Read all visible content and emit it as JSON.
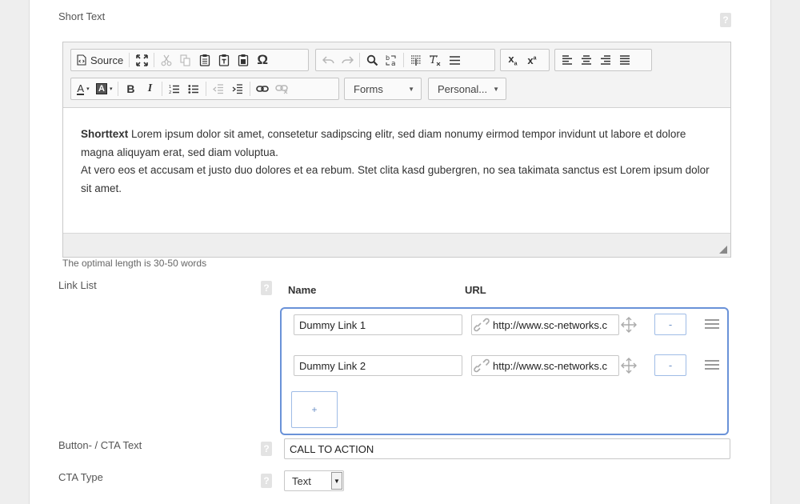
{
  "short_text": {
    "label": "Short Text",
    "help": "?",
    "hint": "The optimal length is 30-50 words"
  },
  "toolbar": {
    "source_label": "Source",
    "forms_label": "Forms",
    "personal_label": "Personal..."
  },
  "editor_content": {
    "bold_word": "Shorttext",
    "para1_rest": " Lorem ipsum dolor sit amet, consetetur sadipscing elitr, sed diam nonumy eirmod tempor invidunt ut labore et dolore magna aliquyam erat, sed diam voluptua.",
    "para2": "At vero eos et accusam et justo duo dolores et ea rebum. Stet clita kasd gubergren, no sea takimata sanctus est Lorem ipsum dolor sit amet."
  },
  "link_list": {
    "label": "Link List",
    "help": "?",
    "col_name": "Name",
    "col_url": "URL",
    "rows": [
      {
        "name": "Dummy Link 1",
        "url": "http://www.sc-networks.c",
        "remove": "-"
      },
      {
        "name": "Dummy Link 2",
        "url": "http://www.sc-networks.c",
        "remove": "-"
      }
    ],
    "add": "+"
  },
  "cta_text": {
    "label": "Button- / CTA Text",
    "help": "?",
    "value": "CALL TO ACTION"
  },
  "cta_type": {
    "label": "CTA Type",
    "help": "?",
    "value": "Text"
  },
  "colors": {
    "focus_border": "#6a92d8",
    "panel_bg": "#ffffff",
    "page_bg": "#eeeeee"
  }
}
